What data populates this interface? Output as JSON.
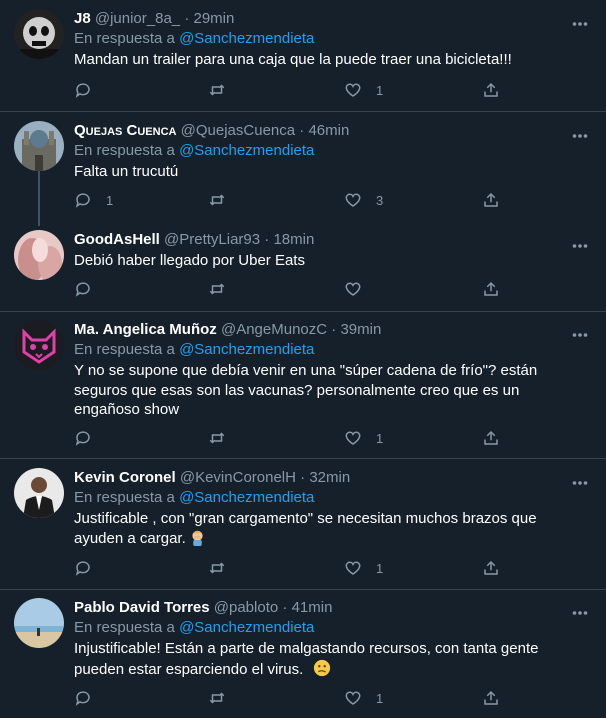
{
  "colors": {
    "background": "#15202b",
    "divider": "#38444d",
    "mention": "#1da1f2",
    "muted": "#8899a6",
    "text": "#ffffff"
  },
  "reply_prefix": "En respuesta a",
  "tweets": [
    {
      "name": "J8",
      "handle": "@junior_8a_",
      "separator": "·",
      "time": "29min",
      "reply_to": "@Sanchezmendieta",
      "text": "Mandan un trailer para una caja que la puede traer una bicicleta!!!",
      "reply_count": "",
      "like_count": "1",
      "avatar_icon": "dark-skull-avatar"
    },
    {
      "name": "Quejas Cuenca",
      "handle": "@QuejasCuenca",
      "separator": "·",
      "time": "46min",
      "reply_to": "@Sanchezmendieta",
      "text": "Falta un trucutú",
      "reply_count": "1",
      "like_count": "3",
      "avatar_icon": "cathedral-avatar"
    },
    {
      "name": "GoodAsHell",
      "handle": "@PrettyLiar93",
      "separator": "·",
      "time": "18min",
      "reply_to": "",
      "text": "Debió haber llegado por Uber Eats",
      "reply_count": "",
      "like_count": "",
      "avatar_icon": "pink-photo-avatar"
    },
    {
      "name": "Ma. Angelica Muñoz",
      "handle": "@AngeMunozC",
      "separator": "·",
      "time": "39min",
      "reply_to": "@Sanchezmendieta",
      "text": "Y no se supone que debía venir en una \"súper cadena de frío\"? están seguros que esas son las vacunas? personalmente creo que es un engañoso show",
      "reply_count": "",
      "like_count": "1",
      "avatar_icon": "pink-cat-avatar"
    },
    {
      "name": "Kevin Coronel",
      "handle": "@KevinCoronelH",
      "separator": "·",
      "time": "32min",
      "reply_to": "@Sanchezmendieta",
      "text": "Justificable , con \"gran cargamento\" se necesitan muchos brazos que ayuden a cargar.",
      "reply_count": "",
      "like_count": "1",
      "avatar_icon": "man-suit-avatar",
      "emoji": "facepalm-emoji"
    },
    {
      "name": "Pablo David Torres",
      "handle": "@pabloto",
      "separator": "·",
      "time": "41min",
      "reply_to": "@Sanchezmendieta",
      "text": "Injustificable! Están a parte de malgastando recursos, con tanta gente pueden estar esparciendo el virus.",
      "reply_count": "",
      "like_count": "1",
      "avatar_icon": "beach-avatar",
      "emoji": "confused-face-emoji"
    }
  ]
}
